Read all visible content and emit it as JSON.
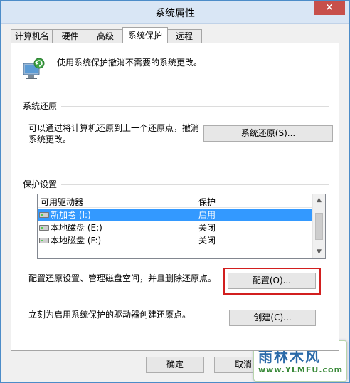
{
  "window": {
    "title": "系统属性",
    "close_glyph": "×"
  },
  "tabs": [
    {
      "label": "计算机名"
    },
    {
      "label": "硬件"
    },
    {
      "label": "高级"
    },
    {
      "label": "系统保护"
    },
    {
      "label": "远程"
    }
  ],
  "intro": "使用系统保护撤消不需要的系统更改。",
  "restore": {
    "group_label": "系统还原",
    "desc_line1": "可以通过将计算机还原到上一个还原点，撤消",
    "desc_line2": "系统更改。",
    "button": "系统还原(S)..."
  },
  "protection": {
    "group_label": "保护设置",
    "columns": {
      "drive": "可用驱动器",
      "protect": "保护"
    },
    "rows": [
      {
        "name": "新加卷 (I:)",
        "protect": "启用"
      },
      {
        "name": "本地磁盘 (E:)",
        "protect": "关闭"
      },
      {
        "name": "本地磁盘 (F:)",
        "protect": "关闭"
      }
    ],
    "selected_index": 0,
    "configure_desc": "配置还原设置、管理磁盘空间，并且删除还原点。",
    "configure_button": "配置(O)...",
    "create_desc": "立刻为启用系统保护的驱动器创建还原点。",
    "create_button": "创建(C)..."
  },
  "footer": {
    "ok": "确定",
    "cancel": "取消"
  },
  "watermark": {
    "main": "雨林木风",
    "url": "www.YLMFU.com"
  },
  "colors": {
    "selection": "#3399ff",
    "highlight_border": "#d21f1f"
  }
}
